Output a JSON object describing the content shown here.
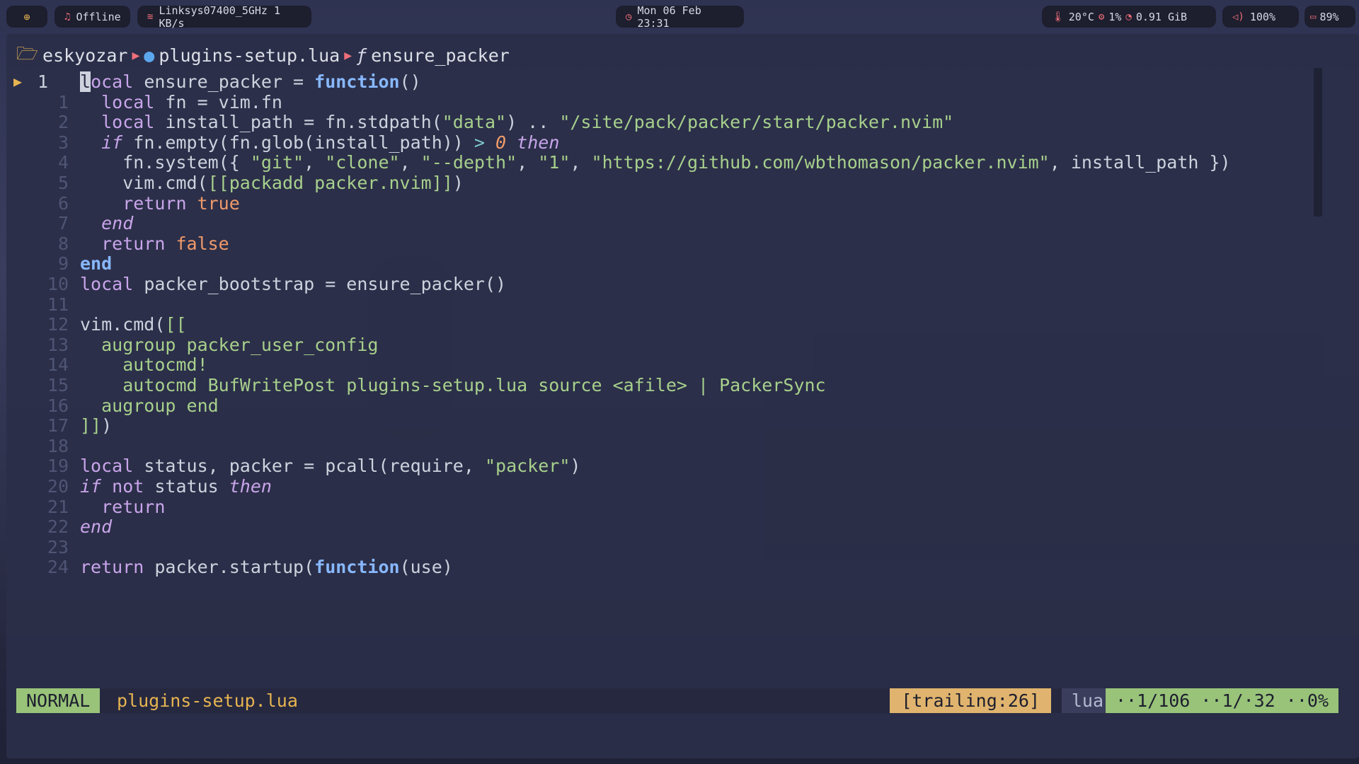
{
  "topbar": {
    "workspace_icon": "globe-icon",
    "music_status": "Offline",
    "wifi": "Linksys07400_5GHz 1 KB/s",
    "datetime": "Mon 06 Feb 23:31",
    "temperature": "20°C",
    "cpu": "1%",
    "memory": "0.91 GiB",
    "volume": "100%",
    "battery": "89%"
  },
  "breadcrumb": {
    "folder": "eskyozar",
    "file": "plugins-setup.lua",
    "symbol_icon": "ƒ",
    "symbol": "ensure_packer"
  },
  "editor": {
    "current_line_number": "1",
    "lines": [
      {
        "n": "",
        "segs": [
          {
            "t": "l",
            "c": "cursor"
          },
          {
            "t": "ocal",
            "c": "kw"
          },
          {
            "t": " ensure_packer = ",
            "c": "plain"
          },
          {
            "t": "function",
            "c": "fnkw"
          },
          {
            "t": "()",
            "c": "plain"
          }
        ]
      },
      {
        "n": "1",
        "segs": [
          {
            "t": "  local",
            "c": "kw"
          },
          {
            "t": " fn = vim.fn",
            "c": "plain"
          }
        ]
      },
      {
        "n": "2",
        "segs": [
          {
            "t": "  local",
            "c": "kw"
          },
          {
            "t": " install_path = fn.stdpath(",
            "c": "plain"
          },
          {
            "t": "\"data\"",
            "c": "str"
          },
          {
            "t": ") .. ",
            "c": "plain"
          },
          {
            "t": "\"/site/pack/packer/start/packer.nvim\"",
            "c": "str"
          }
        ]
      },
      {
        "n": "3",
        "segs": [
          {
            "t": "  if",
            "c": "ital"
          },
          {
            "t": " fn.empty(fn.glob(install_path)) ",
            "c": "plain"
          },
          {
            "t": ">",
            "c": "op"
          },
          {
            "t": " ",
            "c": "plain"
          },
          {
            "t": "0",
            "c": "num"
          },
          {
            "t": " then",
            "c": "ital"
          }
        ]
      },
      {
        "n": "4",
        "segs": [
          {
            "t": "    fn.system({ ",
            "c": "plain"
          },
          {
            "t": "\"git\"",
            "c": "str"
          },
          {
            "t": ", ",
            "c": "plain"
          },
          {
            "t": "\"clone\"",
            "c": "str"
          },
          {
            "t": ", ",
            "c": "plain"
          },
          {
            "t": "\"--depth\"",
            "c": "str"
          },
          {
            "t": ", ",
            "c": "plain"
          },
          {
            "t": "\"1\"",
            "c": "str"
          },
          {
            "t": ", ",
            "c": "plain"
          },
          {
            "t": "\"https://github.com/wbthomason/packer.nvim\"",
            "c": "str"
          },
          {
            "t": ", install_path })",
            "c": "plain"
          }
        ]
      },
      {
        "n": "5",
        "segs": [
          {
            "t": "    vim.cmd(",
            "c": "plain"
          },
          {
            "t": "[[packadd packer.nvim]]",
            "c": "str"
          },
          {
            "t": ")",
            "c": "plain"
          }
        ]
      },
      {
        "n": "6",
        "segs": [
          {
            "t": "    return",
            "c": "kw"
          },
          {
            "t": " true",
            "c": "bool"
          }
        ]
      },
      {
        "n": "7",
        "segs": [
          {
            "t": "  end",
            "c": "ital"
          }
        ]
      },
      {
        "n": "8",
        "segs": [
          {
            "t": "  return",
            "c": "kw"
          },
          {
            "t": " false",
            "c": "bool"
          }
        ]
      },
      {
        "n": "9",
        "segs": [
          {
            "t": "end",
            "c": "fnkw"
          }
        ]
      },
      {
        "n": "10",
        "segs": [
          {
            "t": "local",
            "c": "kw"
          },
          {
            "t": " packer_bootstrap = ensure_packer()",
            "c": "plain"
          }
        ]
      },
      {
        "n": "11",
        "segs": []
      },
      {
        "n": "12",
        "segs": [
          {
            "t": "vim.cmd(",
            "c": "plain"
          },
          {
            "t": "[[",
            "c": "str"
          }
        ]
      },
      {
        "n": "13",
        "segs": [
          {
            "t": "  augroup packer_user_config",
            "c": "str"
          }
        ]
      },
      {
        "n": "14",
        "segs": [
          {
            "t": "    autocmd!",
            "c": "str"
          }
        ]
      },
      {
        "n": "15",
        "segs": [
          {
            "t": "    autocmd BufWritePost plugins-setup.lua source <afile> | PackerSync",
            "c": "str"
          }
        ]
      },
      {
        "n": "16",
        "segs": [
          {
            "t": "  augroup end",
            "c": "str"
          }
        ]
      },
      {
        "n": "17",
        "segs": [
          {
            "t": "]]",
            "c": "str"
          },
          {
            "t": ")",
            "c": "plain"
          }
        ]
      },
      {
        "n": "18",
        "segs": []
      },
      {
        "n": "19",
        "segs": [
          {
            "t": "local",
            "c": "kw"
          },
          {
            "t": " status, packer = pcall(require, ",
            "c": "plain"
          },
          {
            "t": "\"packer\"",
            "c": "str"
          },
          {
            "t": ")",
            "c": "plain"
          }
        ]
      },
      {
        "n": "20",
        "segs": [
          {
            "t": "if",
            "c": "ital"
          },
          {
            "t": " not",
            "c": "kw"
          },
          {
            "t": " status ",
            "c": "plain"
          },
          {
            "t": "then",
            "c": "ital"
          }
        ]
      },
      {
        "n": "21",
        "segs": [
          {
            "t": "  return",
            "c": "kw"
          }
        ]
      },
      {
        "n": "22",
        "segs": [
          {
            "t": "end",
            "c": "ital"
          }
        ]
      },
      {
        "n": "23",
        "segs": []
      },
      {
        "n": "24",
        "segs": [
          {
            "t": "return",
            "c": "kw"
          },
          {
            "t": " packer.startup(",
            "c": "plain"
          },
          {
            "t": "function",
            "c": "fnkw"
          },
          {
            "t": "(use)",
            "c": "plain"
          }
        ]
      }
    ]
  },
  "statusline": {
    "mode": "NORMAL",
    "filename": "plugins-setup.lua",
    "trailing": "[trailing:26]",
    "filetype": "lua",
    "position": "··1/106 ··1/·32 ··0%"
  },
  "colors": {
    "accent_red": "#ef6f7a",
    "mode_green": "#98c379",
    "trailing_yellow": "#e0b46e",
    "filename_yellow": "#e6b450"
  }
}
